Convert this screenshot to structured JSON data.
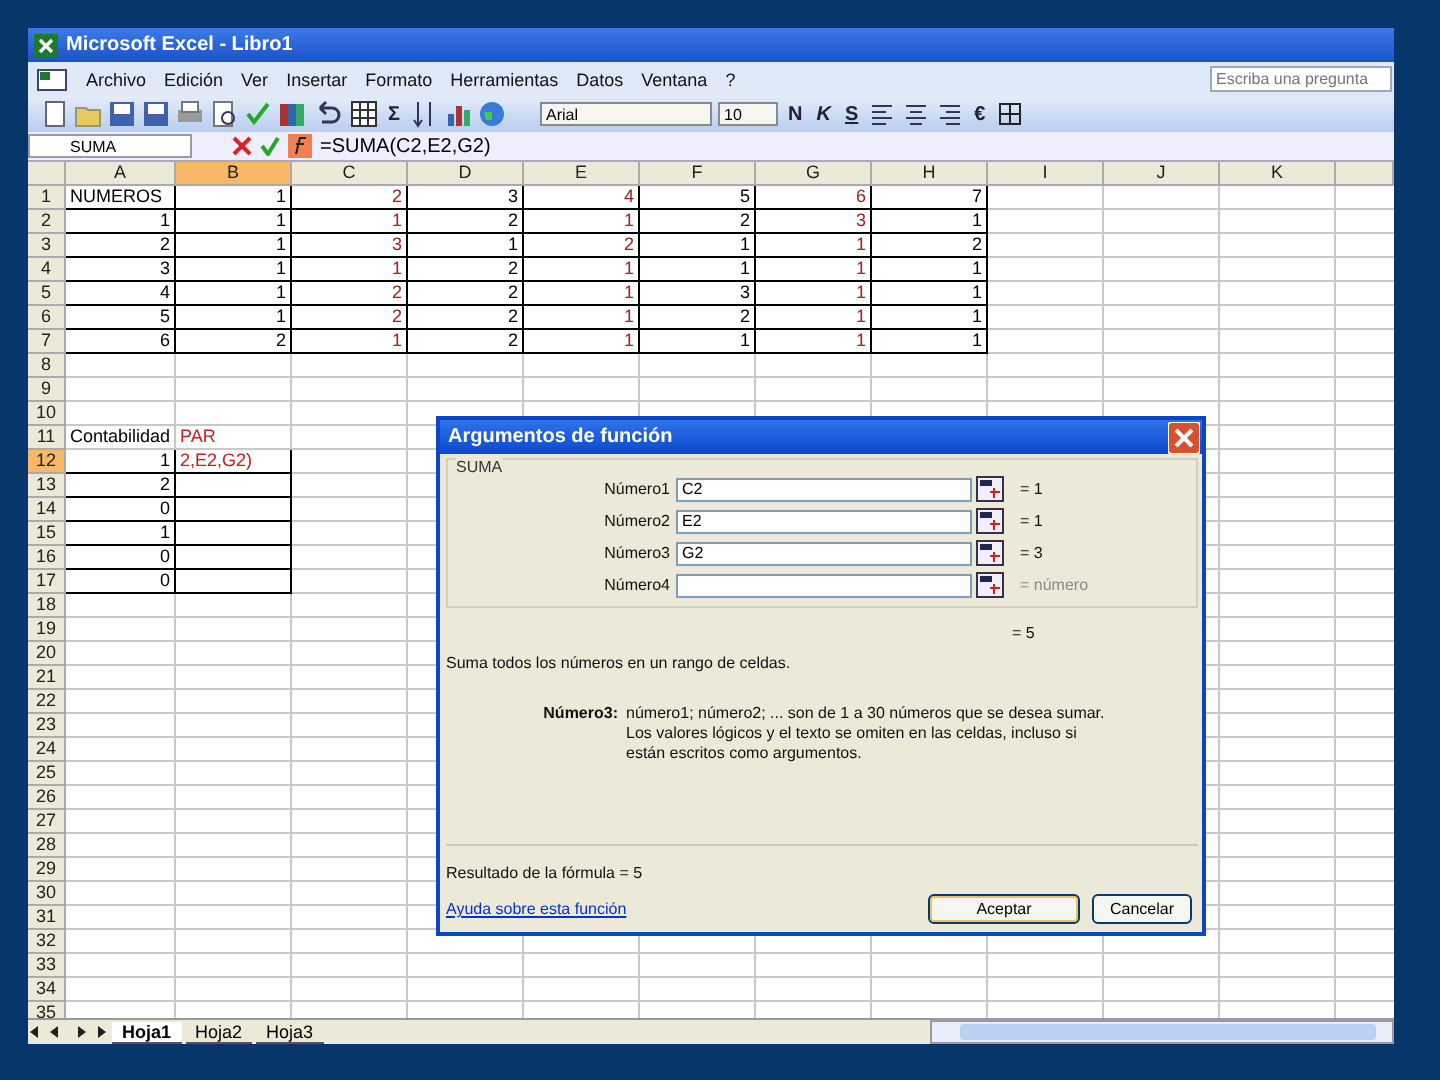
{
  "window": {
    "title": "Microsoft Excel - Libro1"
  },
  "menu": [
    "Archivo",
    "Edición",
    "Ver",
    "Insertar",
    "Formato",
    "Herramientas",
    "Datos",
    "Ventana",
    "?"
  ],
  "help_box": {
    "placeholder": "Escriba una pregunta"
  },
  "toolbar": {
    "sum": "Σ",
    "font": "Arial",
    "size": "10",
    "style_buttons": [
      "N",
      "K",
      "S"
    ],
    "currency": "€"
  },
  "formula_bar": {
    "name_box": "SUMA",
    "formula": "=SUMA(C2,E2,G2)"
  },
  "sheet": {
    "columns": [
      {
        "label": "A",
        "selected": false
      },
      {
        "label": "B",
        "selected": true
      },
      {
        "label": "C",
        "selected": false
      },
      {
        "label": "D",
        "selected": false
      },
      {
        "label": "E",
        "selected": false
      },
      {
        "label": "F",
        "selected": false
      },
      {
        "label": "G",
        "selected": false
      },
      {
        "label": "H",
        "selected": false
      },
      {
        "label": "I",
        "selected": false
      },
      {
        "label": "J",
        "selected": false
      },
      {
        "label": "K",
        "selected": false
      }
    ],
    "rows": [
      {
        "label": "1",
        "selected": false,
        "cells": [
          {
            "text": "NUMEROS",
            "kind": "text",
            "color": "#000000",
            "bordered": true
          },
          {
            "text": "1",
            "kind": "number",
            "color": "#000000",
            "bordered": true
          },
          {
            "text": "2",
            "kind": "number",
            "color": "#a02020",
            "bordered": true
          },
          {
            "text": "3",
            "kind": "number",
            "color": "#000000",
            "bordered": true
          },
          {
            "text": "4",
            "kind": "number",
            "color": "#a02020",
            "bordered": true
          },
          {
            "text": "5",
            "kind": "number",
            "color": "#000000",
            "bordered": true
          },
          {
            "text": "6",
            "kind": "number",
            "color": "#a02020",
            "bordered": true
          },
          {
            "text": "7",
            "kind": "number",
            "color": "#000000",
            "bordered": true
          }
        ]
      },
      {
        "label": "2",
        "selected": false,
        "cells": [
          {
            "text": "1",
            "kind": "number",
            "color": "#000000",
            "bordered": true
          },
          {
            "text": "1",
            "kind": "number",
            "color": "#000000",
            "bordered": true
          },
          {
            "text": "1",
            "kind": "number",
            "color": "#a02020",
            "bordered": true
          },
          {
            "text": "2",
            "kind": "number",
            "color": "#000000",
            "bordered": true
          },
          {
            "text": "1",
            "kind": "number",
            "color": "#a02020",
            "bordered": true
          },
          {
            "text": "2",
            "kind": "number",
            "color": "#000000",
            "bordered": true
          },
          {
            "text": "3",
            "kind": "number",
            "color": "#a02020",
            "bordered": true
          },
          {
            "text": "1",
            "kind": "number",
            "color": "#000000",
            "bordered": true
          }
        ]
      },
      {
        "label": "3",
        "selected": false,
        "cells": [
          {
            "text": "2",
            "kind": "number",
            "color": "#000000",
            "bordered": true
          },
          {
            "text": "1",
            "kind": "number",
            "color": "#000000",
            "bordered": true
          },
          {
            "text": "3",
            "kind": "number",
            "color": "#a02020",
            "bordered": true
          },
          {
            "text": "1",
            "kind": "number",
            "color": "#000000",
            "bordered": true
          },
          {
            "text": "2",
            "kind": "number",
            "color": "#a02020",
            "bordered": true
          },
          {
            "text": "1",
            "kind": "number",
            "color": "#000000",
            "bordered": true
          },
          {
            "text": "1",
            "kind": "number",
            "color": "#a02020",
            "bordered": true
          },
          {
            "text": "2",
            "kind": "number",
            "color": "#000000",
            "bordered": true
          }
        ]
      },
      {
        "label": "4",
        "selected": false,
        "cells": [
          {
            "text": "3",
            "kind": "number",
            "color": "#000000",
            "bordered": true
          },
          {
            "text": "1",
            "kind": "number",
            "color": "#000000",
            "bordered": true
          },
          {
            "text": "1",
            "kind": "number",
            "color": "#a02020",
            "bordered": true
          },
          {
            "text": "2",
            "kind": "number",
            "color": "#000000",
            "bordered": true
          },
          {
            "text": "1",
            "kind": "number",
            "color": "#a02020",
            "bordered": true
          },
          {
            "text": "1",
            "kind": "number",
            "color": "#000000",
            "bordered": true
          },
          {
            "text": "1",
            "kind": "number",
            "color": "#a02020",
            "bordered": true
          },
          {
            "text": "1",
            "kind": "number",
            "color": "#000000",
            "bordered": true
          }
        ]
      },
      {
        "label": "5",
        "selected": false,
        "cells": [
          {
            "text": "4",
            "kind": "number",
            "color": "#000000",
            "bordered": true
          },
          {
            "text": "1",
            "kind": "number",
            "color": "#000000",
            "bordered": true
          },
          {
            "text": "2",
            "kind": "number",
            "color": "#a02020",
            "bordered": true
          },
          {
            "text": "2",
            "kind": "number",
            "color": "#000000",
            "bordered": true
          },
          {
            "text": "1",
            "kind": "number",
            "color": "#a02020",
            "bordered": true
          },
          {
            "text": "3",
            "kind": "number",
            "color": "#000000",
            "bordered": true
          },
          {
            "text": "1",
            "kind": "number",
            "color": "#a02020",
            "bordered": true
          },
          {
            "text": "1",
            "kind": "number",
            "color": "#000000",
            "bordered": true
          }
        ]
      },
      {
        "label": "6",
        "selected": false,
        "cells": [
          {
            "text": "5",
            "kind": "number",
            "color": "#000000",
            "bordered": true
          },
          {
            "text": "1",
            "kind": "number",
            "color": "#000000",
            "bordered": true
          },
          {
            "text": "2",
            "kind": "number",
            "color": "#a02020",
            "bordered": true
          },
          {
            "text": "2",
            "kind": "number",
            "color": "#000000",
            "bordered": true
          },
          {
            "text": "1",
            "kind": "number",
            "color": "#a02020",
            "bordered": true
          },
          {
            "text": "2",
            "kind": "number",
            "color": "#000000",
            "bordered": true
          },
          {
            "text": "1",
            "kind": "number",
            "color": "#a02020",
            "bordered": true
          },
          {
            "text": "1",
            "kind": "number",
            "color": "#000000",
            "bordered": true
          }
        ]
      },
      {
        "label": "7",
        "selected": false,
        "cells": [
          {
            "text": "6",
            "kind": "number",
            "color": "#000000",
            "bordered": true
          },
          {
            "text": "2",
            "kind": "number",
            "color": "#000000",
            "bordered": true
          },
          {
            "text": "1",
            "kind": "number",
            "color": "#a02020",
            "bordered": true
          },
          {
            "text": "2",
            "kind": "number",
            "color": "#000000",
            "bordered": true
          },
          {
            "text": "1",
            "kind": "number",
            "color": "#a02020",
            "bordered": true
          },
          {
            "text": "1",
            "kind": "number",
            "color": "#000000",
            "bordered": true
          },
          {
            "text": "1",
            "kind": "number",
            "color": "#a02020",
            "bordered": true
          },
          {
            "text": "1",
            "kind": "number",
            "color": "#000000",
            "bordered": true
          }
        ]
      },
      {
        "label": "8",
        "selected": false
      },
      {
        "label": "9",
        "selected": false
      },
      {
        "label": "10",
        "selected": false
      },
      {
        "label": "11",
        "selected": false,
        "cells": [
          {
            "text": "Contabilidad",
            "kind": "text",
            "color": "#000000",
            "bordered": false
          },
          {
            "text": "PAR",
            "kind": "text",
            "color": "#c02020",
            "bordered": false
          }
        ]
      },
      {
        "label": "12",
        "selected": true,
        "cells": [
          {
            "text": "1",
            "kind": "number",
            "color": "#000000",
            "bordered": true
          },
          {
            "text": "2,E2,G2)",
            "kind": "text",
            "color": "#c02020",
            "bordered": true
          }
        ]
      },
      {
        "label": "13",
        "selected": false,
        "cells": [
          {
            "text": "2",
            "kind": "number",
            "color": "#000000",
            "bordered": true
          },
          {
            "bordered": true
          }
        ]
      },
      {
        "label": "14",
        "selected": false,
        "cells": [
          {
            "text": "0",
            "kind": "number",
            "color": "#000000",
            "bordered": true
          },
          {
            "bordered": true
          }
        ]
      },
      {
        "label": "15",
        "selected": false,
        "cells": [
          {
            "text": "1",
            "kind": "number",
            "color": "#000000",
            "bordered": true
          },
          {
            "bordered": true
          }
        ]
      },
      {
        "label": "16",
        "selected": false,
        "cells": [
          {
            "text": "0",
            "kind": "number",
            "color": "#000000",
            "bordered": true
          },
          {
            "bordered": true
          }
        ]
      },
      {
        "label": "17",
        "selected": false,
        "cells": [
          {
            "text": "0",
            "kind": "number",
            "color": "#000000",
            "bordered": true
          },
          {
            "bordered": true
          }
        ]
      },
      {
        "label": "18",
        "selected": false
      },
      {
        "label": "19",
        "selected": false
      },
      {
        "label": "20",
        "selected": false
      },
      {
        "label": "21",
        "selected": false
      },
      {
        "label": "22",
        "selected": false
      },
      {
        "label": "23",
        "selected": false
      },
      {
        "label": "24",
        "selected": false
      },
      {
        "label": "25",
        "selected": false
      },
      {
        "label": "26",
        "selected": false
      },
      {
        "label": "27",
        "selected": false
      },
      {
        "label": "28",
        "selected": false
      },
      {
        "label": "29",
        "selected": false
      },
      {
        "label": "30",
        "selected": false
      },
      {
        "label": "31",
        "selected": false
      },
      {
        "label": "32",
        "selected": false
      },
      {
        "label": "33",
        "selected": false
      },
      {
        "label": "34",
        "selected": false
      },
      {
        "label": "35",
        "selected": false
      }
    ]
  },
  "sheet_tabs": [
    {
      "label": "Hoja1",
      "selected": true
    },
    {
      "label": "Hoja2",
      "selected": false
    },
    {
      "label": "Hoja3",
      "selected": false
    }
  ],
  "dialog": {
    "title": "Argumentos de función",
    "function": "SUMA",
    "arguments": [
      {
        "label": "Número1",
        "value": "C2",
        "result": "= 1",
        "hint": false
      },
      {
        "label": "Número2",
        "value": "E2",
        "result": "= 1",
        "hint": false
      },
      {
        "label": "Número3",
        "value": "G2",
        "result": "= 3",
        "hint": false
      },
      {
        "label": "Número4",
        "result": "= número",
        "hint": true
      }
    ],
    "total": "= 5",
    "description": "Suma todos los números en un rango de celdas.",
    "argument_label": "Número3:",
    "argument_help": "número1; número2; ... son de 1 a 30 números que se desea sumar. Los valores lógicos y el texto se omiten en las celdas, incluso si están escritos como argumentos.",
    "formula_result": "Resultado de la fórmula =  5",
    "help_link": "Ayuda sobre esta función",
    "buttons": [
      "Aceptar",
      "Cancelar"
    ]
  }
}
